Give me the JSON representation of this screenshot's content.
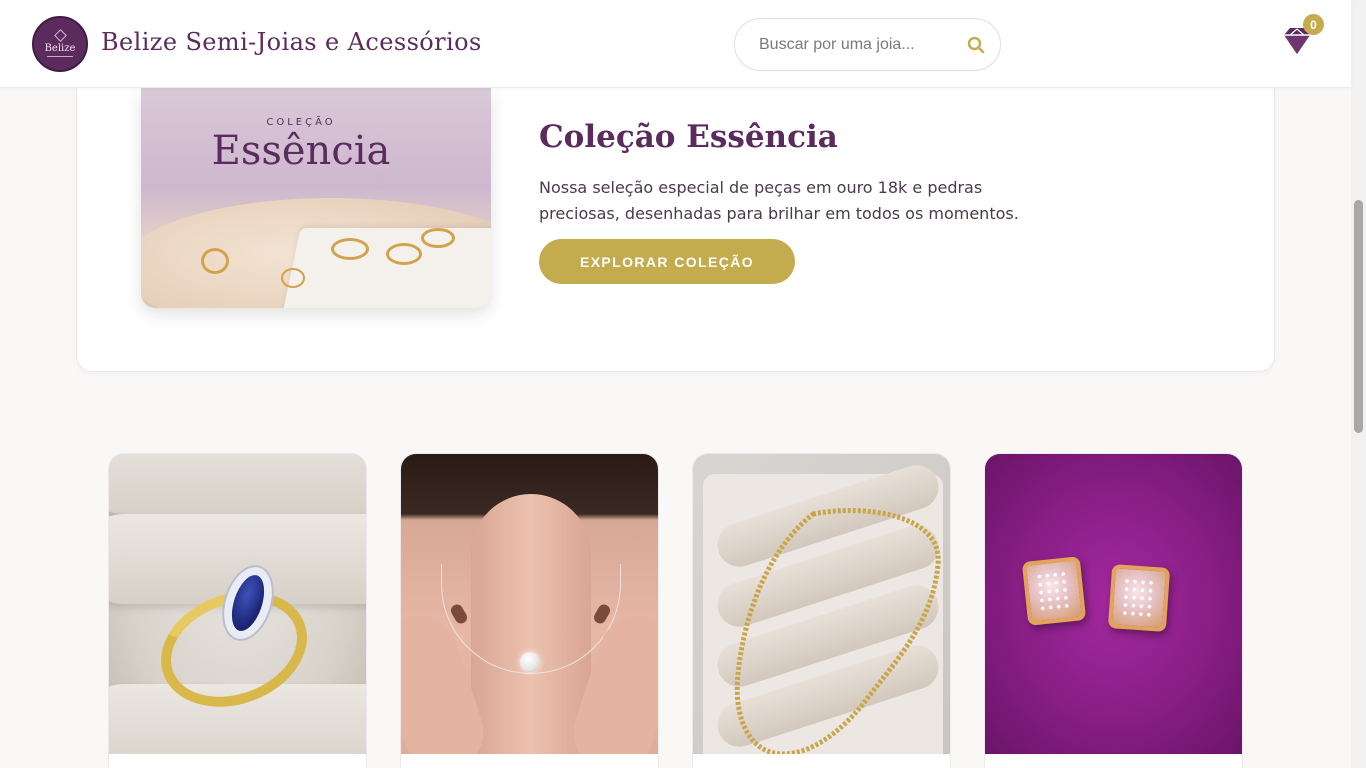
{
  "header": {
    "logo_text": "Belize",
    "brand_name": "Belize Semi-Joias e Acessórios",
    "search_placeholder": "Buscar por uma joia...",
    "cart_count": "0"
  },
  "collection": {
    "image_kicker": "COLEÇÃO",
    "image_title": "Essência",
    "title": "Coleção Essência",
    "description": "Nossa seleção especial de peças em ouro 18k e pedras preciosas, desenhadas para brilhar em todos os momentos.",
    "button_label": "EXPLORAR COLEÇÃO"
  },
  "products": [
    {
      "image_icon": "sapphire-ring-photo"
    },
    {
      "image_icon": "solitaire-necklace-photo"
    },
    {
      "image_icon": "gold-chain-bracelet-photo"
    },
    {
      "image_icon": "square-stud-earrings-photo"
    }
  ],
  "colors": {
    "brand_purple": "#5b2b5e",
    "accent_gold": "#c4ac4e",
    "background": "#f9f8f7"
  }
}
